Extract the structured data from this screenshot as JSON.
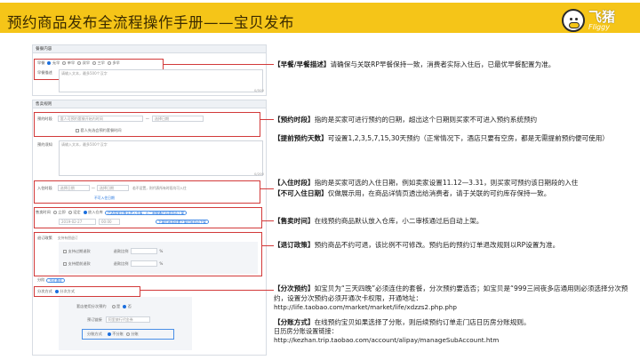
{
  "header": {
    "title": "预约商品发布全流程操作手册——宝贝发布",
    "logo_cn": "飞猪",
    "logo_en": "Fliggy"
  },
  "form": {
    "section_meal": {
      "title": "餐餐内容",
      "meal_label": "早餐",
      "meal_options": [
        "无早",
        "单早",
        "双早",
        "三早",
        "多早"
      ],
      "meal_desc_label": "早餐描述",
      "meal_desc_placeholder": "请输入文本，最多500个汉字",
      "counter": "0/500"
    },
    "section_sale": {
      "title": "售卖规则",
      "book_period_label": "预约时段",
      "book_period_start": "套人可预约套餐开始内时间",
      "book_period_end": "选择日期",
      "book_advance_label": "套人先选会预约套餐时间",
      "book_note_label": "预约须知",
      "book_note_placeholder": "请输入文本，最多500个汉字",
      "counter2": "0/200",
      "checkin_label": "入住时段",
      "checkin_start": "选择日期",
      "checkin_end": "选择日期",
      "checkin_hint": "若不设置，则代表所有时段均可入住",
      "no_checkin_label": "不可入住日期",
      "sale_time_label": "售卖时间",
      "sale_options": [
        "立即",
        "设定",
        "放入仓库"
      ],
      "sale_tip": "已选择宝贝默认进入仓库，小二审核通过后将自动上架",
      "sale_date": "2019-02-27",
      "sale_clock": "00:00",
      "sale_tip2": "下架时间将依据下架时间自动下架",
      "refund_label": "退订政策",
      "refund_value": "支持有偿退订",
      "refund_sub1": "支持过期退款",
      "refund_sub2": "支持提前退款",
      "refund_ratio_label": "退款比例",
      "refund_unit": "%",
      "stage_label": "分阶",
      "stage_option": "不可退改",
      "stage_mode_label": "分次方式",
      "stage_mode_value": "分次方式",
      "stage_count_label": "套店使用分次预约",
      "stage_yes": "是",
      "stage_no": "否",
      "stage_link_label": "预订链接",
      "stage_link_value": "阿里旅行代金券",
      "split_label": "分账方式",
      "split_options": [
        "不分账",
        "分账"
      ]
    }
  },
  "notes": {
    "meal": {
      "kw": "【早餐/早餐描述】",
      "text": "请确保与关联RP早餐保持一致，消费者实际入住后，已最优早餐配置为准。"
    },
    "book": {
      "kw": "【预约时段】",
      "text": "指的是买家可进行预约的日期，超出这个日期则买家不可进入预约系统预约"
    },
    "advance": {
      "kw": "【提前预约天数】",
      "text": "可设置1,2,3,5,7,15,30天预约（正常情况下，酒店只要有空房，都是无需提前预约便可使用）"
    },
    "checkin": {
      "kw": "【入住时段】",
      "text": "指的是买家可选的入住日期，例如卖家设置11.12—3.31，则买家可预约该日期段的入住"
    },
    "no_checkin": {
      "kw": "【不可入住日期】",
      "text": "仅做展示用，在商品详情页透出给消费者，请于关联的可约库存保持一致。"
    },
    "sale": {
      "kw": "【售卖时间】",
      "text": "在线预约商品默认放入仓库，小二审核通过后自动上架。"
    },
    "refund": {
      "kw": "【退订政策】",
      "text": "预约商品不约可退，该比例不可修改。预约后的预约订单退改规则以RP设置为准。"
    },
    "stage": {
      "kw": "【分次预约】",
      "text": "如宝贝为“三天四晚”必须连住的套餐，分次预约要选否；如宝贝是“999三间夜多店通用则必须选择分次预约，设置分次预约必须开通次卡权限，开通地址：",
      "link": "http://life.taobao.com/market/market/life/xdzzs2.php.php"
    },
    "split": {
      "kw": "【分账方式】",
      "text": "在线预约宝贝如果选择了分账，则后续预约订单走门店日历房分账规则。",
      "sub": "日历房分账设置链接：",
      "link": "http://kezhan.trip.taobao.com/account/alipay/manageSubAccount.htm"
    }
  }
}
